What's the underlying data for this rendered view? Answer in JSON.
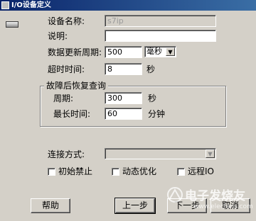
{
  "window": {
    "title": "I/O设备定义"
  },
  "form": {
    "device_name": {
      "label": "设备名称:",
      "value": "s7ip"
    },
    "description": {
      "label": "说明:",
      "value": ""
    },
    "update_cycle": {
      "label": "数据更新周期:",
      "value": "500",
      "unit": "毫秒"
    },
    "timeout": {
      "label": "超时时间:",
      "value": "8",
      "unit": "秒"
    }
  },
  "recovery_group": {
    "title": "故障后恢复查询",
    "period": {
      "label": "周期:",
      "value": "300",
      "unit": "秒"
    },
    "max_time": {
      "label": "最长时间:",
      "value": "60",
      "unit": "分钟"
    }
  },
  "connection": {
    "label": "连接方式:",
    "value": ""
  },
  "options": {
    "init_disable": "初始禁止",
    "dynamic_optimize": "动态优化",
    "remote_io": "远程IO"
  },
  "buttons": {
    "help": "帮助",
    "prev": "上一步",
    "next": "下一步",
    "cancel": "取消"
  },
  "watermark": {
    "text": "电子发烧友",
    "site": "www.elecfans.com"
  }
}
